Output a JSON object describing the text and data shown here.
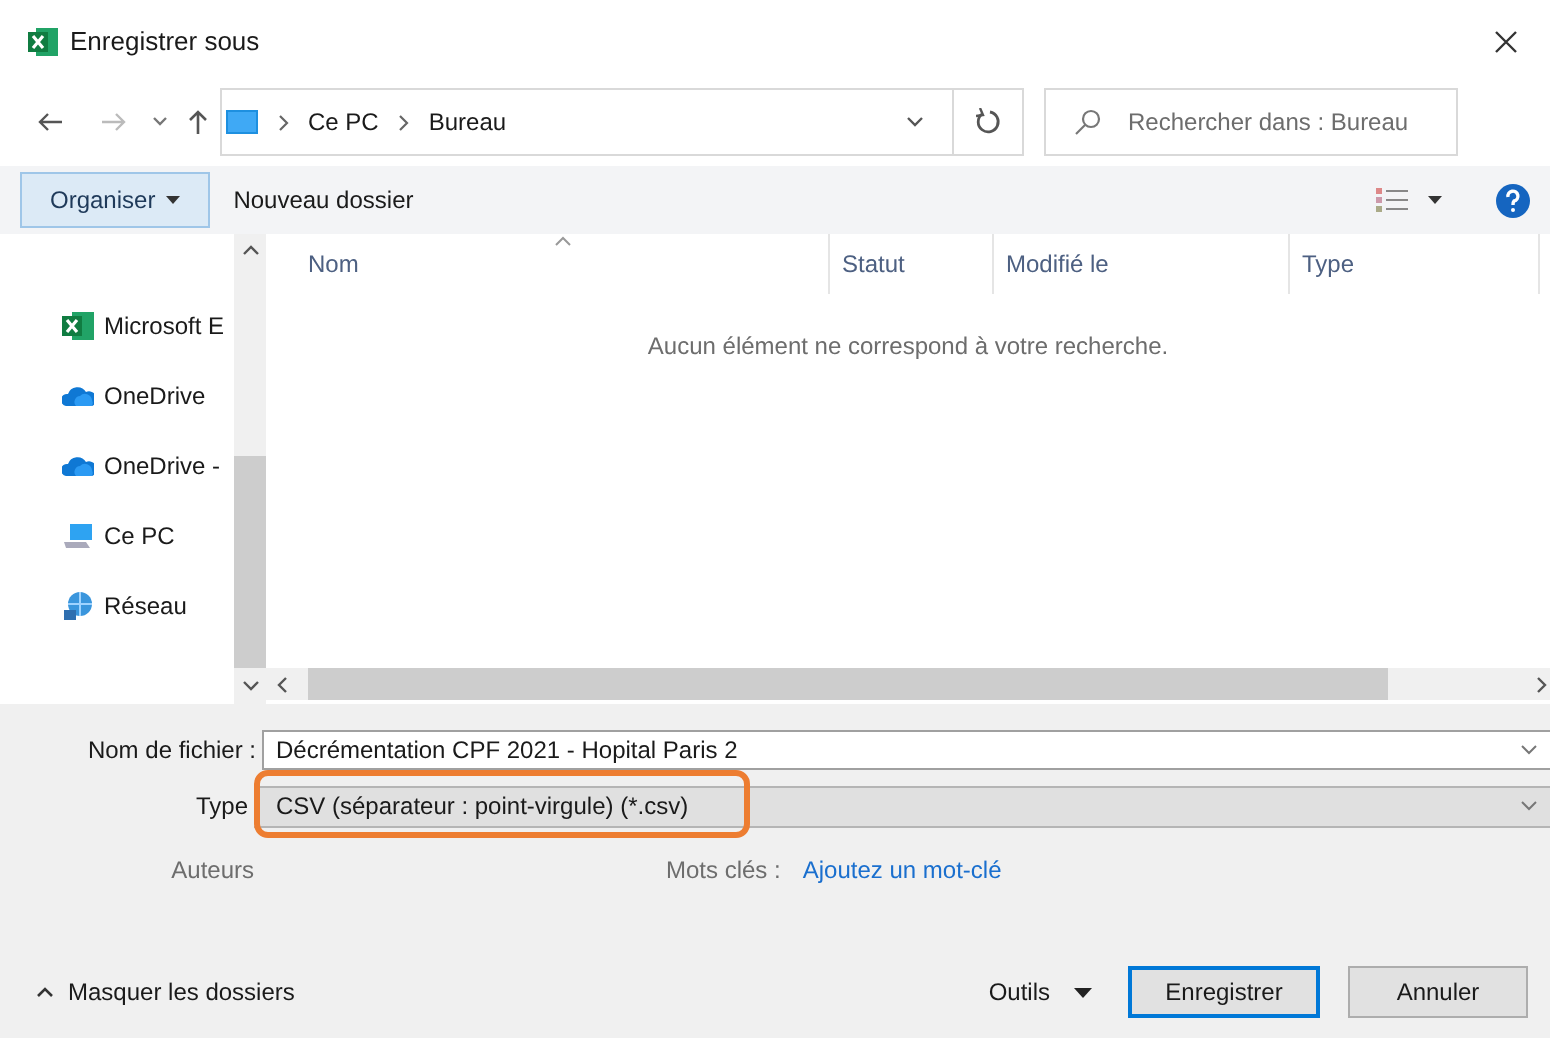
{
  "window": {
    "title": "Enregistrer sous"
  },
  "address_bar": {
    "path": [
      "Ce PC",
      "Bureau"
    ]
  },
  "search": {
    "placeholder": "Rechercher dans : Bureau"
  },
  "toolbar": {
    "organize": "Organiser",
    "new_folder": "Nouveau dossier"
  },
  "sidebar": {
    "items": [
      {
        "label": "Microsoft E",
        "kind": "excel"
      },
      {
        "label": "OneDrive",
        "kind": "cloud"
      },
      {
        "label": "OneDrive -",
        "kind": "cloud"
      },
      {
        "label": "Ce PC",
        "kind": "computer"
      },
      {
        "label": "Réseau",
        "kind": "network"
      }
    ]
  },
  "file_list": {
    "columns": [
      "Nom",
      "Statut",
      "Modifié le",
      "Type"
    ],
    "empty_message": "Aucun élément ne correspond à votre recherche."
  },
  "form": {
    "filename_label": "Nom de fichier :",
    "filename": "Décrémentation CPF 2021 - Hopital Paris 2",
    "type_label": "Type",
    "type": "CSV (séparateur : point-virgule) (*.csv)",
    "authors_label": "Auteurs",
    "tags_label": "Mots clés :",
    "tags_placeholder": "Ajoutez un mot-clé"
  },
  "footer": {
    "hide_folders": "Masquer les dossiers",
    "tools": "Outils",
    "save": "Enregistrer",
    "cancel": "Annuler"
  }
}
